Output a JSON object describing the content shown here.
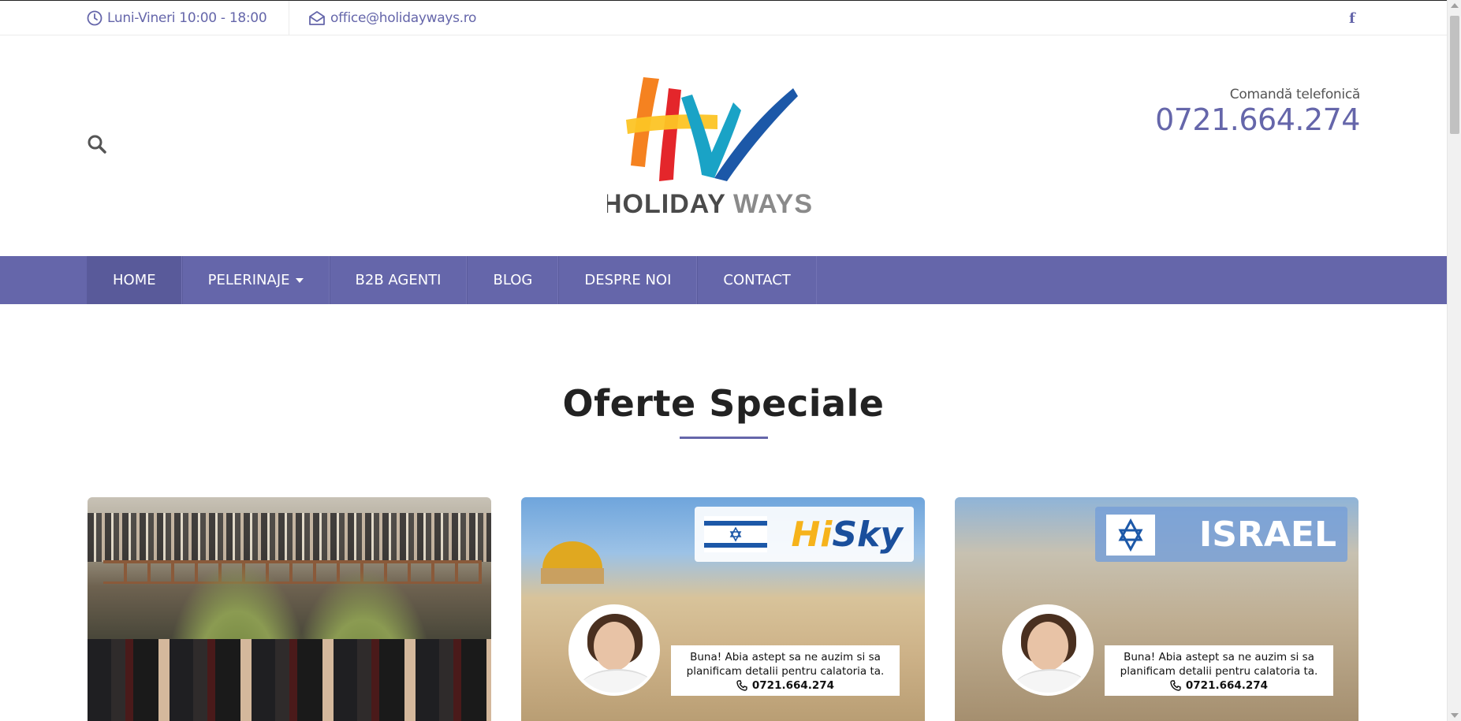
{
  "topbar": {
    "hours": "Luni-Vineri 10:00 - 18:00",
    "email": "office@holidayways.ro",
    "facebook": "f"
  },
  "header": {
    "logo_text_dark": "HOLIDAY",
    "logo_text_light": "WAYS",
    "phone_label": "Comandă telefonică",
    "phone_number": "0721.664.274"
  },
  "nav": {
    "items": [
      {
        "label": "HOME"
      },
      {
        "label": "PELERINAJE"
      },
      {
        "label": "B2B AGENTI"
      },
      {
        "label": "BLOG"
      },
      {
        "label": "DESPRE NOI"
      },
      {
        "label": "CONTACT"
      }
    ]
  },
  "section": {
    "title": "Oferte Speciale"
  },
  "cards": [
    {},
    {
      "banner": {
        "hi": "Hi",
        "sky": "Sky"
      },
      "message": "Buna! Abia astept sa ne auzim si sa planificam detalii pentru calatoria ta.",
      "phone": "0721.664.274"
    },
    {
      "banner": {
        "text": "ISRAEL"
      },
      "message": "Buna! Abia astept sa ne auzim si sa planificam detalii pentru calatoria ta.",
      "phone": "0721.664.274"
    }
  ],
  "colors": {
    "brand": "#6566aa",
    "nav_active": "#595a9a",
    "logo_orange": "#f58220",
    "logo_red": "#e4262b",
    "logo_yellow": "#fcc425",
    "logo_teal": "#1aa3c6",
    "logo_blue": "#1c58a8"
  },
  "icons": {
    "hours": "clock-icon",
    "email": "envelope-icon",
    "social": "facebook-icon",
    "search": "search-icon",
    "phone": "phone-icon"
  }
}
